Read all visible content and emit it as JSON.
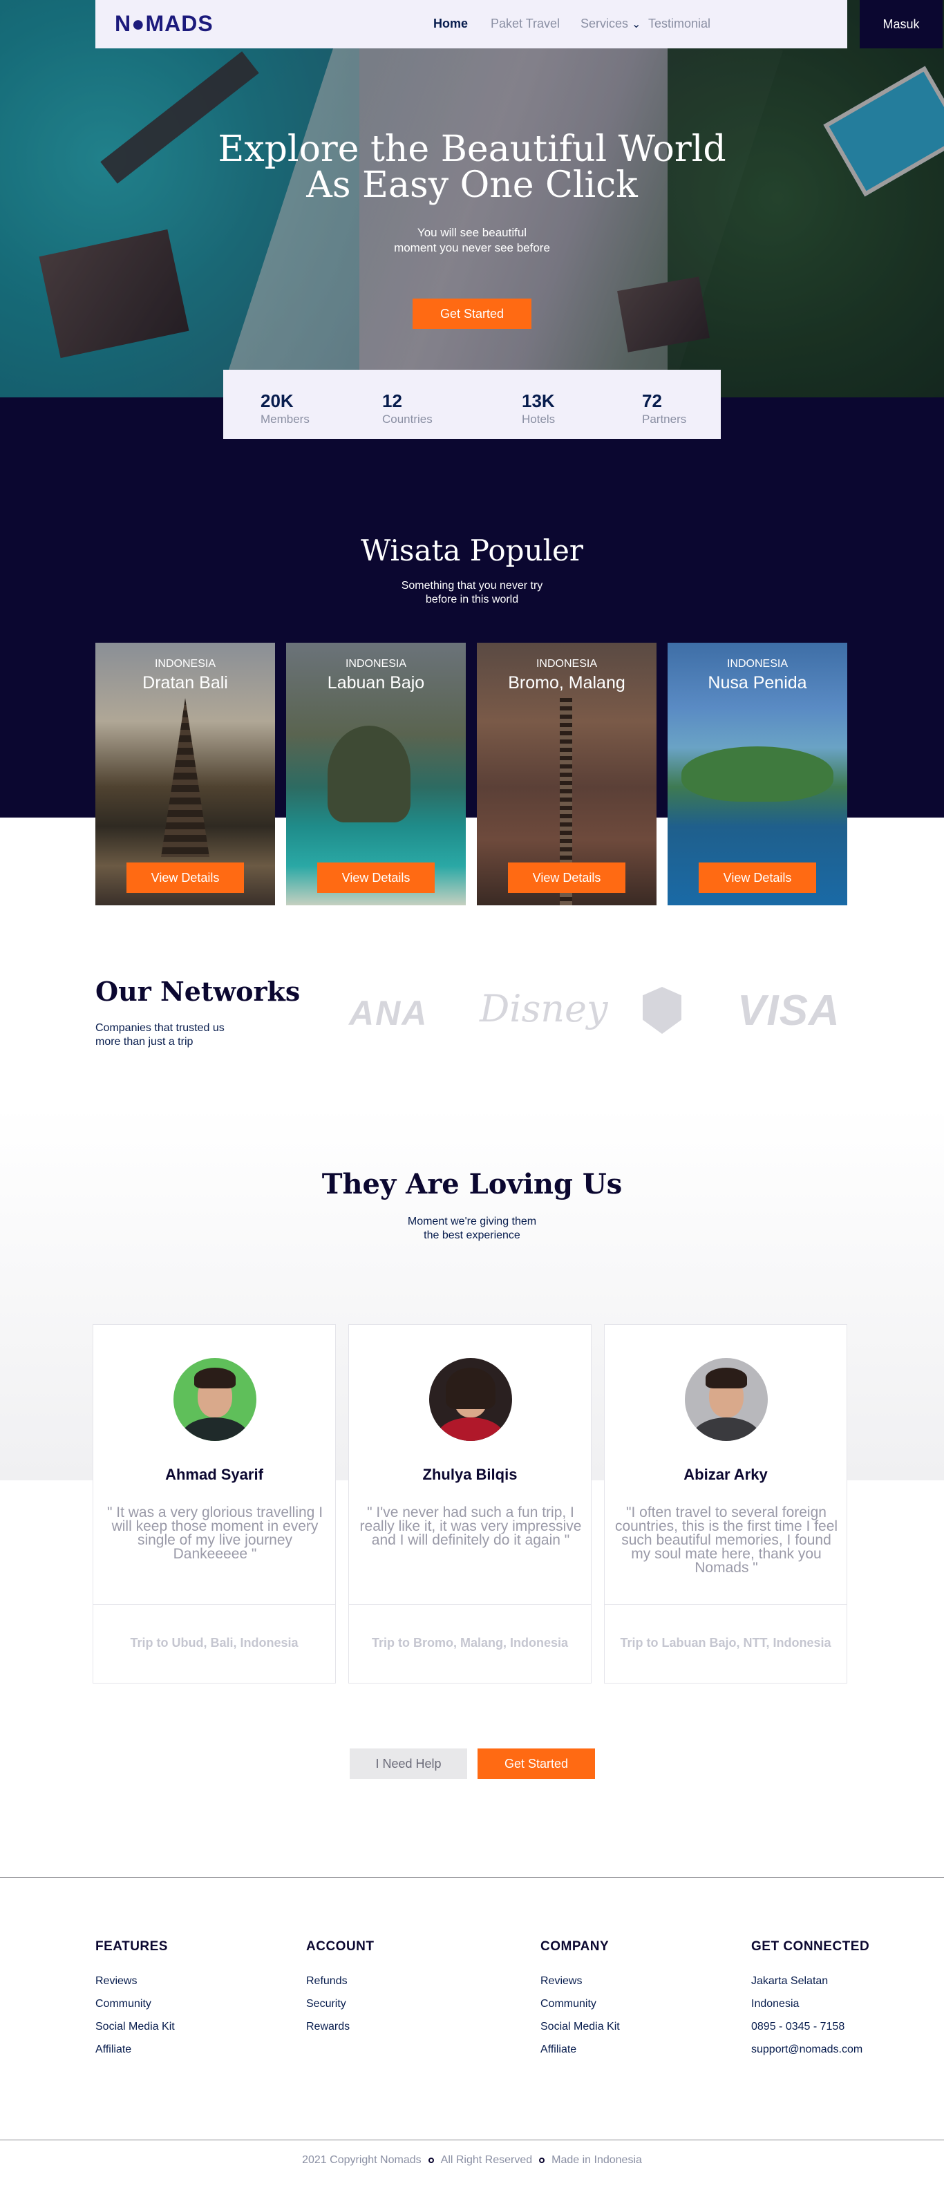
{
  "nav": {
    "logo": "N●MADS",
    "home": "Home",
    "paket_travel": "Paket Travel",
    "services": "Services",
    "testimonial": "Testimonial",
    "masuk": "Masuk"
  },
  "hero": {
    "title_line1": "Explore the Beautiful World",
    "title_line2": "As Easy One Click",
    "subtitle_line1": "You will see beautiful",
    "subtitle_line2": "moment you never see before",
    "cta": "Get Started"
  },
  "stats": [
    {
      "value": "20K",
      "label": "Members"
    },
    {
      "value": "12",
      "label": "Countries"
    },
    {
      "value": "13K",
      "label": "Hotels"
    },
    {
      "value": "72",
      "label": "Partners"
    }
  ],
  "popular": {
    "title": "Wisata Populer",
    "subtitle_line1": "Something that you never try",
    "subtitle_line2": "before in this world",
    "cards": [
      {
        "country": "INDONESIA",
        "name": "Dratan Bali",
        "button": "View Details"
      },
      {
        "country": "INDONESIA",
        "name": "Labuan Bajo",
        "button": "View Details"
      },
      {
        "country": "INDONESIA",
        "name": "Bromo, Malang",
        "button": "View Details"
      },
      {
        "country": "INDONESIA",
        "name": "Nusa Penida",
        "button": "View Details"
      }
    ]
  },
  "networks": {
    "title": "Our Networks",
    "subtitle_line1": "Companies that trusted us",
    "subtitle_line2": "more than just a trip",
    "brands": [
      "ANA",
      "Disney",
      "VISA"
    ]
  },
  "testimonials": {
    "title": "They Are Loving Us",
    "subtitle_line1": "Moment we're giving them",
    "subtitle_line2": "the best experience",
    "items": [
      {
        "name": "Ahmad Syarif",
        "quote": "\" It was a very glorious travelling I will keep those moment in every single of my live journey Dankeeeee \"",
        "trip": "Trip to Ubud, Bali, Indonesia",
        "shirt": "#1f2a2a",
        "bg": "#5fbf5a"
      },
      {
        "name": "Zhulya Bilqis",
        "quote": "\" I've never had such a fun trip, I really like it, it was very impressive and I will definitely do it again \"",
        "trip": "Trip to Bromo, Malang, Indonesia",
        "shirt": "#b0182a",
        "bg": "#2a2020"
      },
      {
        "name": "Abizar Arky",
        "quote": "\"I often travel to several foreign countries, this is the first time I feel such beautiful memories, I found my soul mate here, thank you Nomads \"",
        "trip": "Trip to Labuan Bajo, NTT, Indonesia",
        "shirt": "#3a3a3e",
        "bg": "#b8b8bc"
      }
    ],
    "help": "I Need Help",
    "cta": "Get Started"
  },
  "footer": {
    "columns": [
      {
        "title": "FEATURES",
        "items": [
          "Reviews",
          "Community",
          "Social Media Kit",
          "Affiliate"
        ]
      },
      {
        "title": "ACCOUNT",
        "items": [
          "Refunds",
          "Security",
          "Rewards"
        ]
      },
      {
        "title": "COMPANY",
        "items": [
          "Reviews",
          "Community",
          "Social Media Kit",
          "Affiliate"
        ]
      },
      {
        "title": "GET CONNECTED",
        "items": [
          "Jakarta Selatan",
          "Indonesia",
          "0895 - 0345 - 7158",
          "support@nomads.com"
        ]
      }
    ],
    "copyright": [
      "2021 Copyright Nomads",
      "All Right Reserved",
      "Made in Indonesia"
    ]
  },
  "colors": {
    "navy": "#0b0730",
    "orange": "#ff6a13",
    "nav_bg": "#f2f0fa"
  }
}
